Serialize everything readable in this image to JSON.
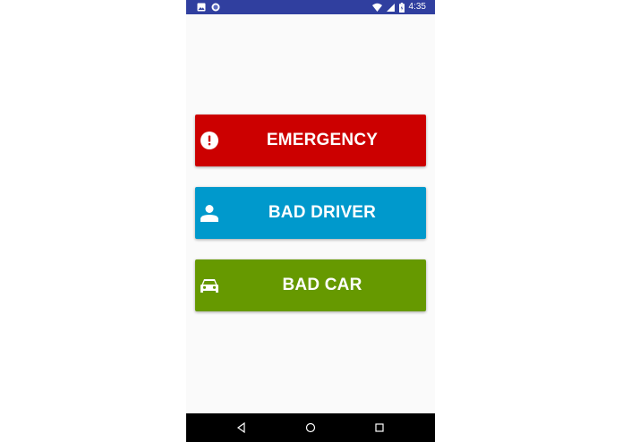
{
  "status_bar": {
    "time": "4:35",
    "icons": [
      "image-icon",
      "sync-icon",
      "wifi-icon",
      "signal-icon",
      "battery-icon"
    ]
  },
  "buttons": [
    {
      "label": "EMERGENCY",
      "icon": "alert-circle-icon",
      "color": "#cc0000"
    },
    {
      "label": "BAD DRIVER",
      "icon": "person-icon",
      "color": "#0099cc"
    },
    {
      "label": "BAD CAR",
      "icon": "car-icon",
      "color": "#669900"
    }
  ],
  "nav_bar": {
    "icons": [
      "back-icon",
      "home-icon",
      "recents-icon"
    ]
  },
  "colors": {
    "status_bar": "#303f9f",
    "background": "#fafafa",
    "nav_bar": "#000000"
  }
}
